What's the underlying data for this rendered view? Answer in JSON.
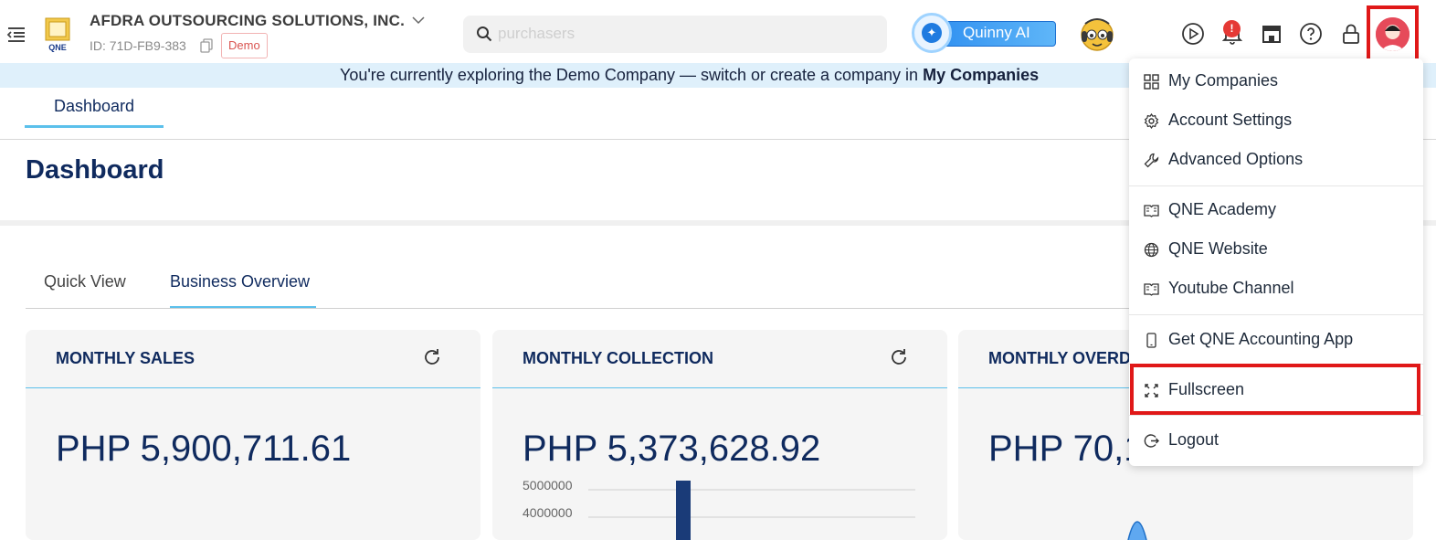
{
  "company": {
    "name": "AFDRA OUTSOURCING SOLUTIONS, INC.",
    "id_text": "ID: 71D-FB9-383",
    "badge": "Demo",
    "logo_text": "QNE"
  },
  "search": {
    "placeholder": "purchasers"
  },
  "assistant": {
    "label": "Quinny AI"
  },
  "notifications": {
    "count": "!"
  },
  "banner": {
    "text": "You're currently exploring the Demo Company — switch or create a company in ",
    "link": "My Companies"
  },
  "page_tab": "Dashboard",
  "page_title": "Dashboard",
  "subtabs": [
    "Quick View",
    "Business Overview"
  ],
  "cards": [
    {
      "title": "MONTHLY SALES",
      "amount": "PHP 5,900,711.61"
    },
    {
      "title": "MONTHLY COLLECTION",
      "amount": "PHP 5,373,628.92",
      "axis_labels": [
        "5000000",
        "4000000"
      ]
    },
    {
      "title": "MONTHLY OVERD",
      "amount": "PHP 70,1"
    }
  ],
  "menu": {
    "items": [
      {
        "label": "My Companies",
        "icon": "grid-icon"
      },
      {
        "label": "Account Settings",
        "icon": "gear-icon"
      },
      {
        "label": "Advanced Options",
        "icon": "wrench-icon"
      },
      {
        "label": "QNE Academy",
        "icon": "book-icon"
      },
      {
        "label": "QNE Website",
        "icon": "globe-icon"
      },
      {
        "label": "Youtube Channel",
        "icon": "book-icon"
      },
      {
        "label": "Get QNE Accounting App",
        "icon": "phone-icon"
      },
      {
        "label": "Fullscreen",
        "icon": "expand-icon"
      },
      {
        "label": "Logout",
        "icon": "logout-icon"
      }
    ]
  },
  "colors": {
    "accent": "#5bc0eb",
    "navy": "#0f2a5e",
    "highlight": "#e01818",
    "banner_bg": "#dff0fb"
  }
}
